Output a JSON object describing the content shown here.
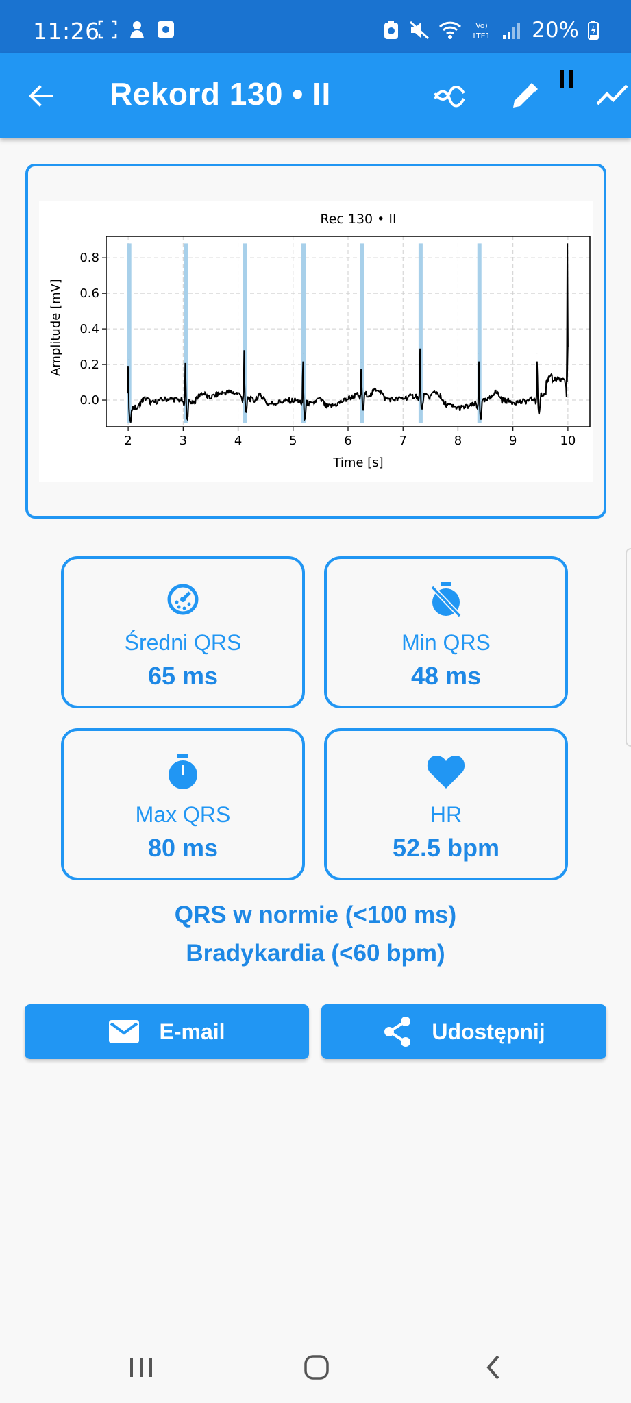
{
  "status_bar": {
    "time": "11:26",
    "battery_pct": "20%"
  },
  "app_bar": {
    "title": "Rekord 130 • II",
    "icons": [
      "back-arrow-icon",
      "crossed-lines-icon",
      "pencil-icon",
      "pause-icon",
      "trend-line-icon"
    ]
  },
  "chart_data": {
    "type": "line",
    "title": "Rec 130 • II",
    "xlabel": "Time [s]",
    "ylabel": "Amplitude [mV]",
    "xlim": [
      1.6,
      10.4
    ],
    "ylim": [
      -0.15,
      0.92
    ],
    "xticks": [
      "2",
      "3",
      "4",
      "5",
      "6",
      "7",
      "8",
      "9",
      "10"
    ],
    "yticks": [
      "0.0",
      "0.2",
      "0.4",
      "0.6",
      "0.8"
    ],
    "grid": true,
    "qrs_markers_s": [
      2.02,
      3.05,
      4.12,
      5.19,
      6.25,
      7.32,
      8.39
    ],
    "r_peaks": [
      {
        "t": 2.0,
        "amp": 0.23
      },
      {
        "t": 3.04,
        "amp": 0.25
      },
      {
        "t": 4.11,
        "amp": 0.28
      },
      {
        "t": 5.18,
        "amp": 0.26
      },
      {
        "t": 6.24,
        "amp": 0.21
      },
      {
        "t": 7.31,
        "amp": 0.29
      },
      {
        "t": 8.38,
        "amp": 0.26
      },
      {
        "t": 9.44,
        "amp": 0.26
      },
      {
        "t": 9.99,
        "amp": 0.88
      }
    ]
  },
  "stats": [
    {
      "icon": "gauge-timer-icon",
      "label": "Średni QRS",
      "value": "65 ms"
    },
    {
      "icon": "timer-off-icon",
      "label": "Min QRS",
      "value": "48 ms"
    },
    {
      "icon": "timer-icon",
      "label": "Max QRS",
      "value": "80 ms"
    },
    {
      "icon": "heart-icon",
      "label": "HR",
      "value": "52.5 bpm"
    }
  ],
  "summary": {
    "line1": "QRS w normie (<100 ms)",
    "line2": "Bradykardia (<60 bpm)"
  },
  "actions": {
    "email_label": "E-mail",
    "share_label": "Udostępnij"
  },
  "colors": {
    "primary": "#2196f3",
    "status_bar": "#1a73d0",
    "text_blue": "#1e88e5",
    "marker": "#a8d0ea"
  }
}
